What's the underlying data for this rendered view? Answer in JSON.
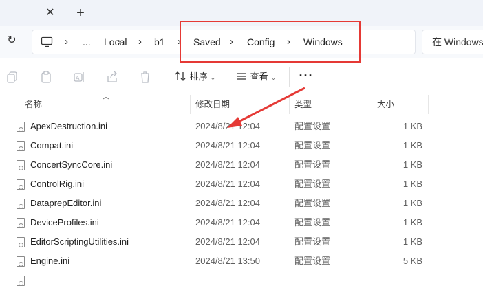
{
  "tabstrip": {
    "close_glyph": "✕",
    "new_tab_glyph": "+"
  },
  "address": {
    "refresh_glyph": "↻",
    "crumbs": [
      "...",
      "Local",
      "b1",
      "Saved",
      "Config",
      "Windows"
    ],
    "separator": "›",
    "search_placeholder": "在 Windows"
  },
  "toolbar": {
    "sort_label": "排序",
    "view_label": "查看",
    "more_label": "···",
    "icons": [
      "copy-icon",
      "paste-icon",
      "rename-icon",
      "share-icon",
      "delete-icon"
    ]
  },
  "columns": {
    "name": "名称",
    "date": "修改日期",
    "type": "类型",
    "size": "大小"
  },
  "files": [
    {
      "name": "ApexDestruction.ini",
      "date": "2024/8/21 12:04",
      "type": "配置设置",
      "size": "1 KB"
    },
    {
      "name": "Compat.ini",
      "date": "2024/8/21 12:04",
      "type": "配置设置",
      "size": "1 KB"
    },
    {
      "name": "ConcertSyncCore.ini",
      "date": "2024/8/21 12:04",
      "type": "配置设置",
      "size": "1 KB"
    },
    {
      "name": "ControlRig.ini",
      "date": "2024/8/21 12:04",
      "type": "配置设置",
      "size": "1 KB"
    },
    {
      "name": "DataprepEditor.ini",
      "date": "2024/8/21 12:04",
      "type": "配置设置",
      "size": "1 KB"
    },
    {
      "name": "DeviceProfiles.ini",
      "date": "2024/8/21 12:04",
      "type": "配置设置",
      "size": "1 KB"
    },
    {
      "name": "EditorScriptingUtilities.ini",
      "date": "2024/8/21 12:04",
      "type": "配置设置",
      "size": "1 KB"
    },
    {
      "name": "Engine.ini",
      "date": "2024/8/21 13:50",
      "type": "配置设置",
      "size": "5 KB"
    }
  ],
  "annotation_color": "#e53935"
}
